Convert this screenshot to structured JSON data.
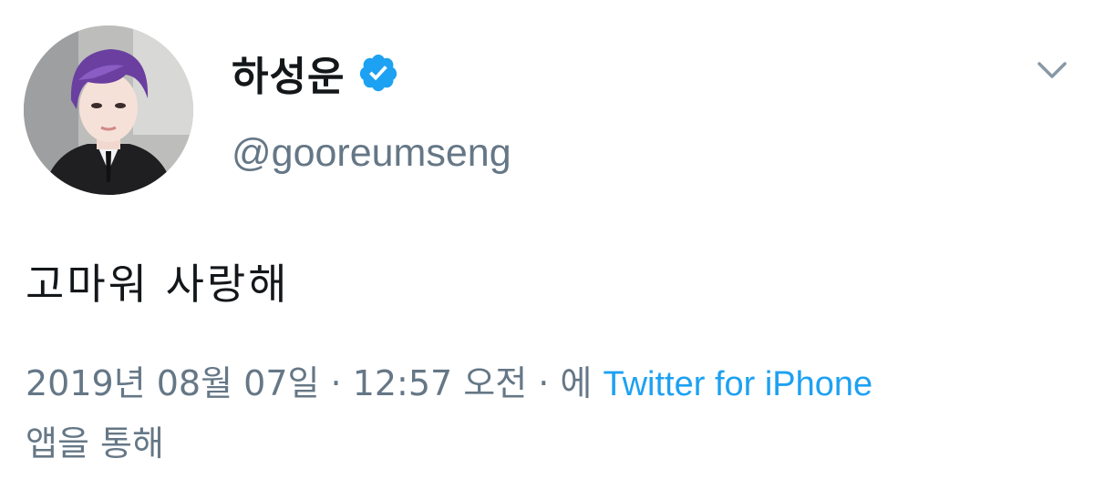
{
  "tweet": {
    "display_name": "하성운",
    "handle": "@gooreumseng",
    "verified": true,
    "text": "고마워 사랑해",
    "meta": {
      "date_time": "2019년 08월 07일 · 12:57 오전 · 에 ",
      "source": "Twitter for iPhone",
      "suffix": "앱을 통해"
    }
  },
  "icons": {
    "verified": "verified-badge-icon",
    "menu": "chevron-down-icon",
    "avatar": "profile-photo"
  },
  "colors": {
    "link": "#1da1f2",
    "secondary_text": "#657786",
    "primary_text": "#14171a",
    "verified_badge": "#1da1f2"
  }
}
